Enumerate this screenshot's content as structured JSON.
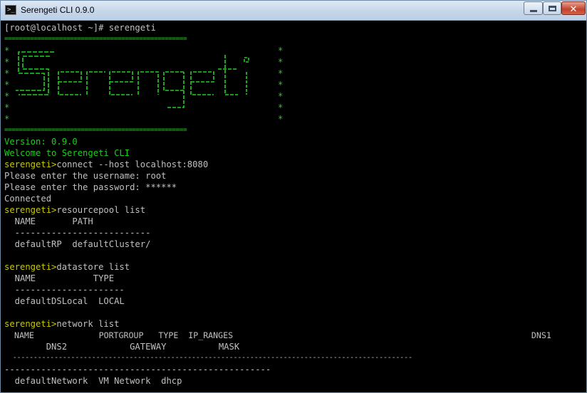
{
  "window": {
    "title": "Serengeti CLI 0.9.0",
    "controls": {
      "minimize": "–",
      "maximize": "□",
      "close": "✕"
    }
  },
  "terminal": {
    "prompt_line": "[root@localhost ~]# serengeti",
    "banner_border": "==================================================",
    "banner_star": "*",
    "banner_logo_text": "Serengeti",
    "version": "Version: 0.9.0",
    "welcome": "Welcome to Serengeti CLI",
    "prompt": "serengeti>",
    "connect_cmd": "connect --host localhost:8080",
    "username_prompt": "Please enter the username: root",
    "password_prompt": "Please enter the password: ******",
    "connected": "Connected",
    "resourcepool": {
      "cmd": "resourcepool list",
      "header": "  NAME       PATH",
      "separator": "  --------------------------",
      "row": "  defaultRP  defaultCluster/"
    },
    "datastore": {
      "cmd": "datastore list",
      "header": "  NAME           TYPE",
      "separator": "  ---------------------",
      "row": "  defaultDSLocal  LOCAL"
    },
    "network": {
      "cmd": "network list",
      "header1": "  NAME             PORTGROUP   TYPE  IP_RANGES                                                            DNS1",
      "header2": "        DNS2            GATEWAY          MASK",
      "separator1": "  ------------------------------------------------------------------------------------------------",
      "separator2": "---------------------------------------------------",
      "row": "  defaultNetwork  VM Network  dhcp"
    }
  },
  "colors": {
    "prompt": "#c8c800",
    "banner": "#1ecf1e",
    "output": "#c0c0c0",
    "background": "#000000"
  },
  "icons": {
    "app": "terminal-icon"
  }
}
